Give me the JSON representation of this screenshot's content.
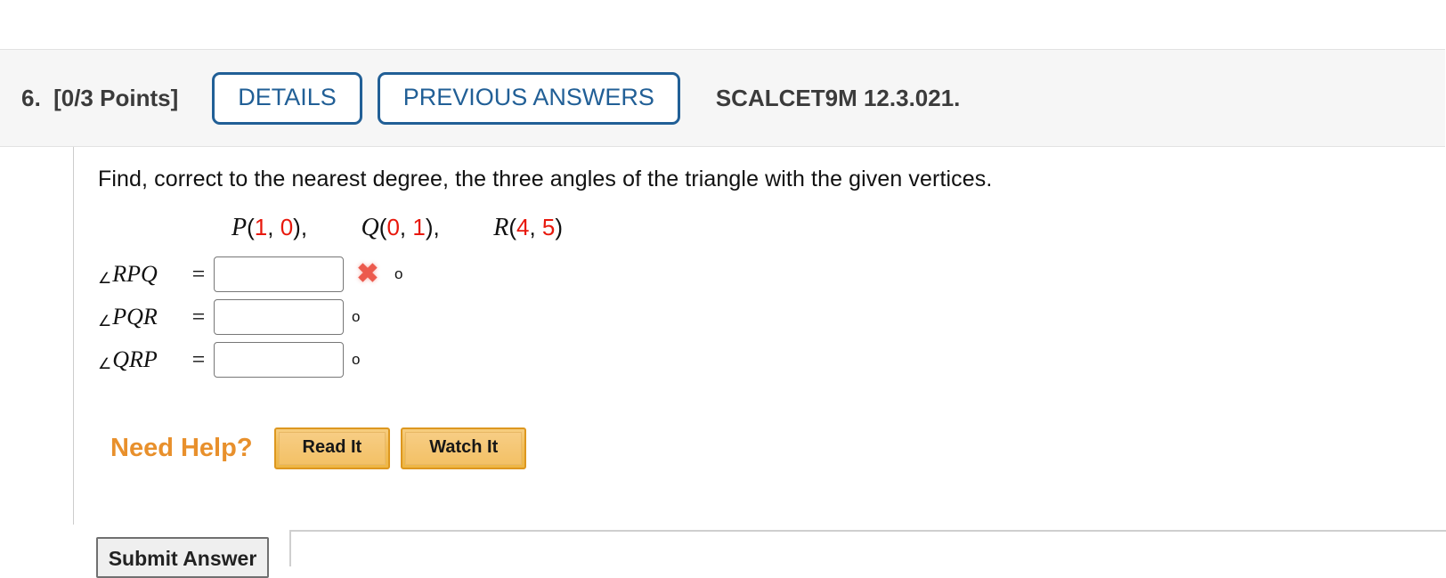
{
  "header": {
    "question_number": "6.",
    "points": "[0/3 Points]",
    "details_label": "DETAILS",
    "previous_answers_label": "PREVIOUS ANSWERS",
    "textbook_reference": "SCALCET9M 12.3.021.",
    "accent_color": "#215f96",
    "background_color": "#f6f6f6"
  },
  "question": {
    "prompt": "Find, correct to the nearest degree, the three angles of the triangle with the given vertices.",
    "vertices": [
      {
        "name": "P",
        "x": "1",
        "y": "0",
        "separator": ","
      },
      {
        "name": "Q",
        "x": "0",
        "y": "1",
        "separator": ","
      },
      {
        "name": "R",
        "x": "4",
        "y": "5",
        "separator": ""
      }
    ],
    "coordinate_color": "#e8180c",
    "angle_symbol": "∠",
    "degree_symbol": "o",
    "equals": "=",
    "answers": [
      {
        "label": "RPQ",
        "value": "",
        "placeholder": "",
        "status": "incorrect",
        "status_mark": "✖",
        "status_color": "#ec5a4d"
      },
      {
        "label": "PQR",
        "value": "",
        "placeholder": "",
        "status": "none",
        "status_mark": "",
        "status_color": ""
      },
      {
        "label": "QRP",
        "value": "",
        "placeholder": "",
        "status": "none",
        "status_mark": "",
        "status_color": ""
      }
    ]
  },
  "need_help": {
    "label": "Need Help?",
    "label_color": "#e8902c",
    "buttons": [
      {
        "label": "Read It"
      },
      {
        "label": "Watch It"
      }
    ]
  },
  "footer": {
    "submit_label": "Submit Answer"
  }
}
